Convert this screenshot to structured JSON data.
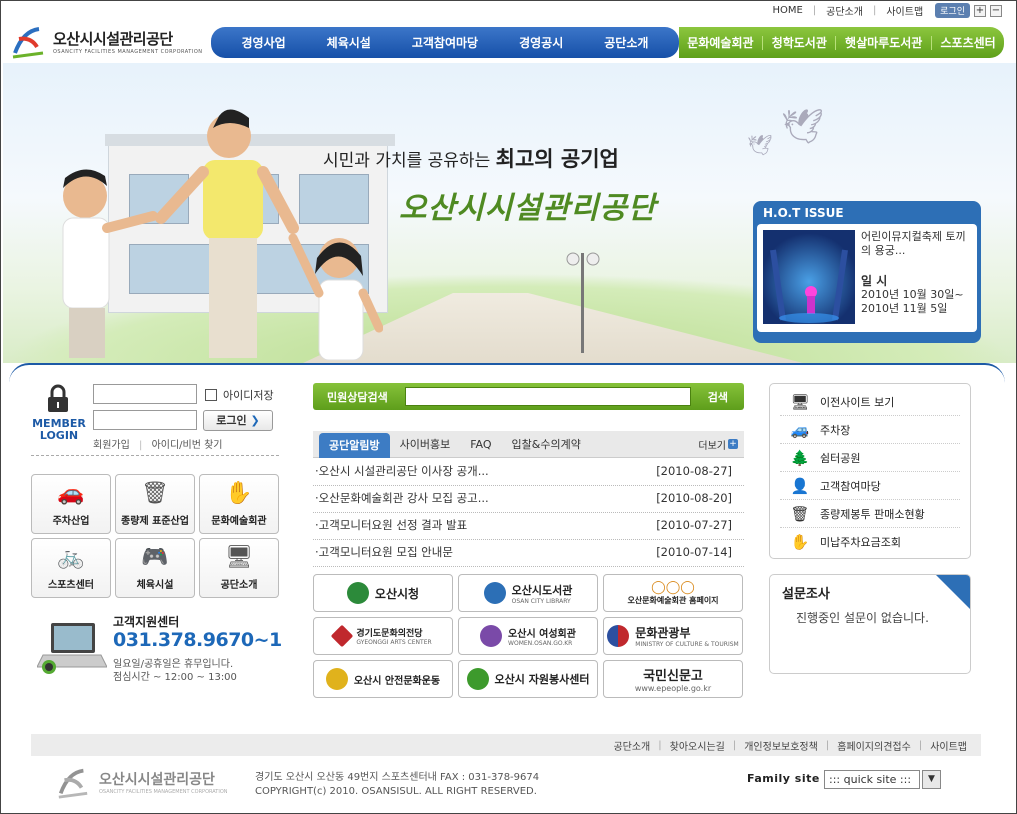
{
  "util": {
    "home": "HOME",
    "about": "공단소개",
    "sitemap": "사이트맵",
    "login": "로그인",
    "zoom_in": "+",
    "zoom_out": "−"
  },
  "logo": {
    "name": "오산시시설관리공단",
    "sub": "OSANCITY FACILITIES MANAGEMENT CORPORATION"
  },
  "main_nav": [
    "경영사업",
    "체육시설",
    "고객참여마당",
    "경영공시",
    "공단소개"
  ],
  "sub_nav": [
    "문화예술회관",
    "청학도서관",
    "햇살마루도서관",
    "스포츠센터"
  ],
  "banner": {
    "slogan_pre": "시민과 가치를 공유하는",
    "slogan_bold": "최고의 공기업",
    "slogan_main": "오산시시설관리공단"
  },
  "hot_issue": {
    "title": "H.O.T ISSUE",
    "text": "어린이뮤지컬축제 토끼의 용궁...",
    "date_label": "일 시",
    "date1": "2010년 10월 30일~",
    "date2": "2010년 11월 5일"
  },
  "login": {
    "member": "MEMBER",
    "login": "LOGIN",
    "save_id": "아이디저장",
    "button": "로그인",
    "join": "회원가입",
    "find": "아이디/비번 찾기"
  },
  "quick": [
    {
      "label": "주차산업",
      "icon": "car-icon",
      "glyph": "🚗"
    },
    {
      "label": "종량제 표준산업",
      "icon": "trash-bag-icon",
      "glyph": "🗑"
    },
    {
      "label": "문화예술회관",
      "icon": "hand-icon",
      "glyph": "✋"
    },
    {
      "label": "스포츠센터",
      "icon": "bicycle-icon",
      "glyph": "🚲"
    },
    {
      "label": "체육시설",
      "icon": "gamepad-icon",
      "glyph": "🎮"
    },
    {
      "label": "공단소개",
      "icon": "monitor-icon",
      "glyph": "🖥"
    }
  ],
  "cs": {
    "title": "고객지원센터",
    "number": "031.378.9670~1",
    "note1": "일요일/공휴일은 휴무입니다.",
    "note2": "점심시간 ~ 12:00 ~ 13:00"
  },
  "search": {
    "label": "민원상담검색",
    "button": "검색",
    "value": ""
  },
  "tabs": [
    "공단알림방",
    "사이버홍보",
    "FAQ",
    "입찰&수의계약"
  ],
  "more": "더보기",
  "news": [
    {
      "title": "·오산시 시설관리공단 이사장 공개...",
      "date": "[2010-08-27]"
    },
    {
      "title": "·오산문화예술회관 강사 모집 공고...",
      "date": "[2010-08-20]"
    },
    {
      "title": "·고객모니터요원 선정 결과 발표",
      "date": "[2010-07-27]"
    },
    {
      "title": "·고객모니터요원 모집 안내문",
      "date": "[2010-07-14]"
    }
  ],
  "banners": [
    {
      "main": "오산시청",
      "sub": "",
      "color": "#2c8a3a"
    },
    {
      "main": "오산시도서관",
      "sub": "OSAN CITY LIBRARY",
      "color": "#2c6fb6"
    },
    {
      "main": "오산문화예술회관 홈페이지",
      "sub": "",
      "color": "#d98a1c"
    },
    {
      "main": "경기도문화의전당",
      "sub": "GYEONGGI ARTS CENTER",
      "color": "#c0282d"
    },
    {
      "main": "오산시 여성회관",
      "sub": "WOMEN.OSAN.GO.KR",
      "color": "#7a4aa8"
    },
    {
      "main": "문화관광부",
      "sub": "MINISTRY OF CULTURE & TOURISM",
      "color": "#c0282d"
    },
    {
      "main": "오산시 안전문화운동",
      "sub": "",
      "color": "#e0b21c"
    },
    {
      "main": "오산시 자원봉사센터",
      "sub": "",
      "color": "#3d9a2c"
    },
    {
      "main": "국민신문고",
      "sub": "www.epeople.go.kr",
      "color": "#555555"
    }
  ],
  "quick_links": [
    {
      "label": "이전사이트 보기",
      "icon": "monitor-icon",
      "glyph": "🖥"
    },
    {
      "label": "주차장",
      "icon": "car-icon",
      "glyph": "🚙"
    },
    {
      "label": "쉼터공원",
      "icon": "tree-icon",
      "glyph": "🌲"
    },
    {
      "label": "고객참여마당",
      "icon": "person-icon",
      "glyph": "👤"
    },
    {
      "label": "종량제봉투 판매소현황",
      "icon": "trash-bag-icon",
      "glyph": "🗑"
    },
    {
      "label": "미납주차요금조회",
      "icon": "hand-icon",
      "glyph": "✋"
    }
  ],
  "poll": {
    "title": "설문조사",
    "message": "진행중인 설문이 없습니다."
  },
  "footer": {
    "links": [
      "공단소개",
      "찾아오시는길",
      "개인정보보호정책",
      "홈페이지의견접수",
      "사이트맵"
    ],
    "address": "경기도 오산시 오산동 49번지 스포츠센터내  FAX : 031-378-9674",
    "copyright": "COPYRIGHT(c) 2010. OSANSISUL. ALL RIGHT RESERVED.",
    "family_label": "Family site",
    "family_value": "::: quick site :::"
  }
}
